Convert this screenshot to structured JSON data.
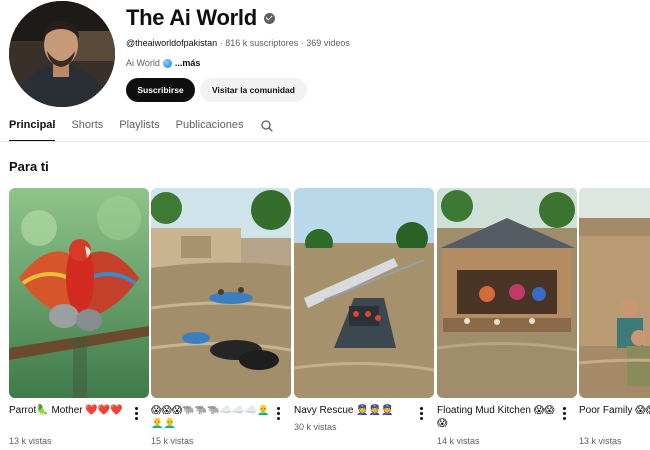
{
  "channel": {
    "name": "The Ai World",
    "handle": "@theaiworldofpakistan",
    "subscribers": "816 k suscriptores",
    "videos": "369 videos",
    "separator": "·",
    "description": "Ai World",
    "more": "...más"
  },
  "buttons": {
    "subscribe": "Suscribirse",
    "community": "Visitar la comunidad"
  },
  "tabs": [
    "Principal",
    "Shorts",
    "Playlists",
    "Publicaciones"
  ],
  "section": {
    "title": "Para ti"
  },
  "shorts": [
    {
      "title": "Parrot🦜 Mother ❤️❤️❤️",
      "views": "13 k vistas"
    },
    {
      "title": "😱😱😱🐃🐃🐃☁️☁️☁️👨‍🦲👨‍🦲👨‍🦲",
      "views": "15 k vistas"
    },
    {
      "title": "Navy Rescue 👮👮👮",
      "views": "30 k vistas"
    },
    {
      "title": "Floating Mud Kitchen 😱😱😱",
      "views": "14 k vistas"
    },
    {
      "title": "Poor Family 😱😱",
      "views": "13 k vistas"
    }
  ],
  "icons": {
    "verified": "verified-check-icon",
    "globe": "globe-icon",
    "search": "search-icon",
    "more": "more-vert-icon"
  }
}
